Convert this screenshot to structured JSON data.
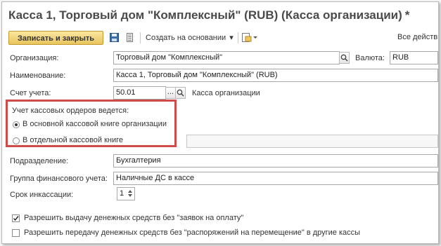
{
  "window": {
    "title": "Касса 1, Торговый дом \"Комплексный\" (RUB) (Касса организации)",
    "modified_mark": "*"
  },
  "toolbar": {
    "save_close": "Записать и закрыть",
    "create_based_on": "Создать на основании",
    "all_actions": "Все действи"
  },
  "form": {
    "organization": {
      "label": "Организация:",
      "value": "Торговый дом \"Комплексный\""
    },
    "currency": {
      "label": "Валюта:",
      "value": "RUB"
    },
    "name": {
      "label": "Наименование:",
      "value": "Касса 1, Торговый дом \"Комплексный\" (RUB)"
    },
    "account": {
      "label": "Счет учета:",
      "value": "50.01",
      "description": "Касса организации"
    },
    "cash_orders": {
      "group_label": "Учет кассовых ордеров ведется:",
      "options": [
        {
          "label": "В основной кассовой книге организации",
          "selected": true
        },
        {
          "label": "В отдельной кассовой книге",
          "selected": false
        }
      ]
    },
    "department": {
      "label": "Подразделение:",
      "value": "Бухгалтерия"
    },
    "finance_group": {
      "label": "Группа финансового учета:",
      "value": "Наличные ДС в кассе"
    },
    "collection_period": {
      "label": "Срок инкассации:",
      "value": "1"
    },
    "allow_issue": {
      "label": "Разрешить выдачу денежных средств без \"заявок на оплату\"",
      "checked": true
    },
    "allow_transfer": {
      "label": "Разрешить передачу денежных средств без \"распоряжений на перемещение\" в другие кассы",
      "checked": false
    }
  },
  "colors": {
    "highlight": "#d04a4a",
    "primary_button": "#f2d27a"
  }
}
